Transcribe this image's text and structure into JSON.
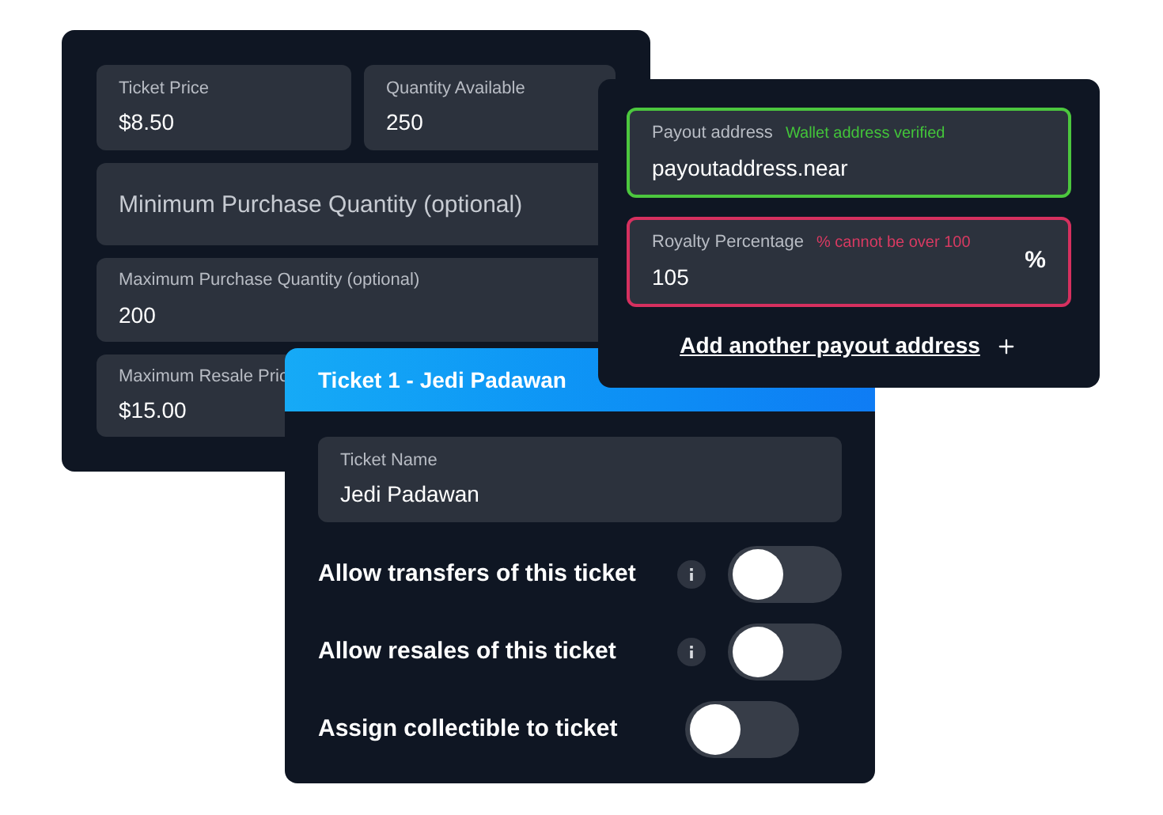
{
  "pricing_card": {
    "fields": [
      {
        "label": "Ticket Price",
        "value": "$8.50"
      },
      {
        "label": "Quantity Available",
        "value": "250"
      },
      {
        "placeholder": "Minimum Purchase Quantity (optional)"
      },
      {
        "label": "Maximum Purchase Quantity (optional)",
        "value": "200"
      },
      {
        "label": "Maximum Resale Pric",
        "value": "$15.00"
      }
    ]
  },
  "payout_card": {
    "fields": [
      {
        "label": "Payout address",
        "status": {
          "kind": "success",
          "text": "Wallet address verified"
        },
        "value": "payoutaddress.near"
      },
      {
        "label": "Royalty Percentage",
        "status": {
          "kind": "error",
          "text": "% cannot be over 100"
        },
        "value": "105",
        "suffix": "%"
      }
    ],
    "add_link": "Add another payout address"
  },
  "ticket_card": {
    "title": "Ticket 1 - Jedi Padawan",
    "name_field": {
      "label": "Ticket Name",
      "value": "Jedi Padawan"
    },
    "toggles": [
      {
        "label": "Allow transfers of this ticket",
        "info": true,
        "on": false
      },
      {
        "label": "Allow resales of this ticket",
        "info": true,
        "on": false
      },
      {
        "label": "Assign collectible to ticket",
        "info": false,
        "on": false
      }
    ]
  }
}
